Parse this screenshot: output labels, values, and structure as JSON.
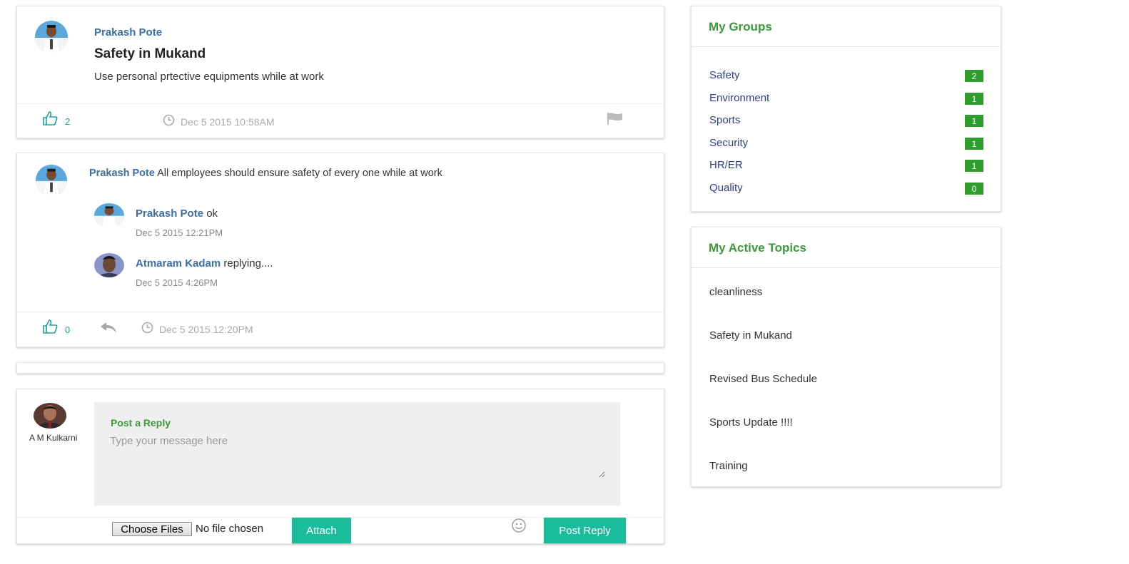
{
  "post": {
    "author": "Prakash Pote",
    "title": "Safety in Mukand",
    "body": "Use personal prtective equipments while at work",
    "likes": "2",
    "timestamp": "Dec 5 2015 10:58AM"
  },
  "comment": {
    "author": "Prakash Pote",
    "text": "All employees should ensure safety of every one while at work",
    "likes": "0",
    "timestamp": "Dec 5 2015 12:20PM",
    "replies": [
      {
        "author": "Prakash Pote",
        "text": "ok",
        "timestamp": "Dec 5 2015 12:21PM"
      },
      {
        "author": "Atmaram Kadam",
        "text": "replying....",
        "timestamp": "Dec 5 2015 4:26PM"
      }
    ]
  },
  "reply_form": {
    "user_name": "A M Kulkarni",
    "label": "Post a Reply",
    "placeholder": "Type your message here",
    "choose_files": "Choose Files",
    "file_status": "No file chosen",
    "attach": "Attach",
    "post_reply": "Post Reply"
  },
  "groups": {
    "title": "My Groups",
    "items": [
      {
        "name": "Safety",
        "count": "2"
      },
      {
        "name": "Environment",
        "count": "1"
      },
      {
        "name": "Sports",
        "count": "1"
      },
      {
        "name": "Security",
        "count": "1"
      },
      {
        "name": "HR/ER",
        "count": "1"
      },
      {
        "name": "Quality",
        "count": "0"
      }
    ]
  },
  "topics": {
    "title": "My Active Topics",
    "items": [
      "cleanliness",
      "Safety in Mukand",
      "Revised Bus Schedule",
      "Sports Update !!!!",
      "Training"
    ]
  },
  "colors": {
    "accent_green": "#3a9a3a",
    "teal": "#1abc9c",
    "badge_green": "#2e9d2e",
    "link_blue": "#3a6ea5"
  }
}
